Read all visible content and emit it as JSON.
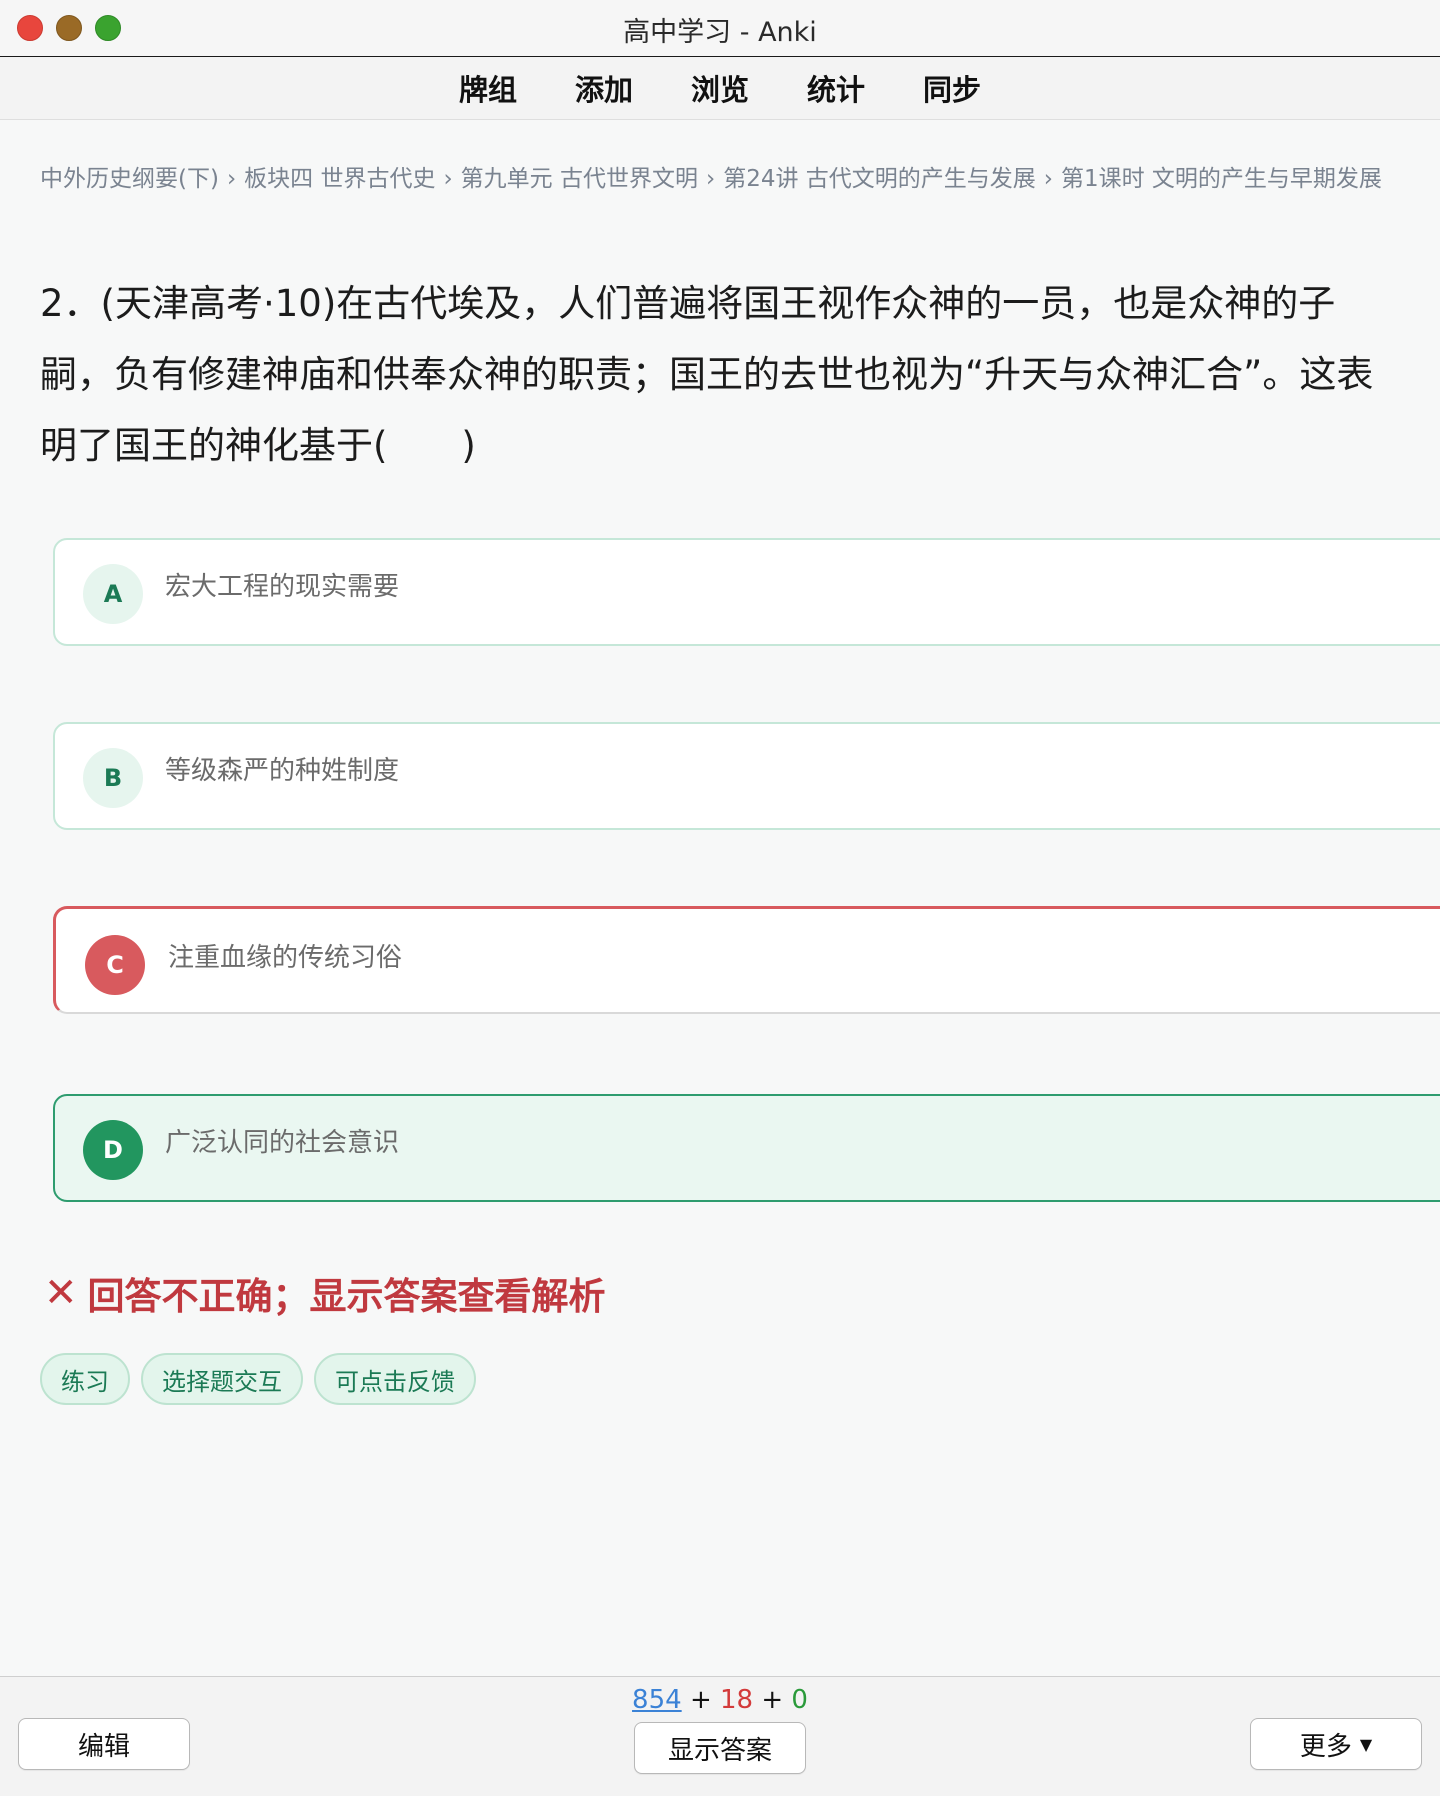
{
  "window": {
    "title": "高中学习 - Anki"
  },
  "toolbar": {
    "items": [
      "牌组",
      "添加",
      "浏览",
      "统计",
      "同步"
    ]
  },
  "breadcrumb": {
    "items": [
      "中外历史纲要(下)",
      "板块四 世界古代史",
      "第九单元 古代世界文明",
      "第24讲 古代文明的产生与发展",
      "第1课时 文明的产生与早期发展"
    ],
    "separator": "›"
  },
  "question": {
    "text": "2．(天津高考·10)在古代埃及，人们普遍将国王视作众神的一员，也是众神的子嗣，负有修建神庙和供奉众神的职责；国王的去世也视为“升天与众神汇合”。这表明了国王的神化基于(　　)"
  },
  "options": [
    {
      "letter": "A",
      "text": "宏大工程的现实需要",
      "state": "default"
    },
    {
      "letter": "B",
      "text": "等级森严的种姓制度",
      "state": "default"
    },
    {
      "letter": "C",
      "text": "注重血缘的传统习俗",
      "state": "selected-wrong"
    },
    {
      "letter": "D",
      "text": "广泛认同的社会意识",
      "state": "correct"
    }
  ],
  "feedback": {
    "icon": "✕",
    "text": "回答不正确；显示答案查看解析"
  },
  "tags": [
    "练习",
    "选择题交互",
    "可点击反馈"
  ],
  "bottom": {
    "counts": {
      "new": "854",
      "learning": "18",
      "review": "0",
      "plus": "+"
    },
    "edit_label": "编辑",
    "show_answer_label": "显示答案",
    "more_label": "更多",
    "more_icon": "caret-down-icon"
  },
  "colors": {
    "correct": "#22965f",
    "wrong": "#d85a5e",
    "new_count": "#3b82d6",
    "learning_count": "#d33a3a",
    "review_count": "#2a9a3a"
  }
}
